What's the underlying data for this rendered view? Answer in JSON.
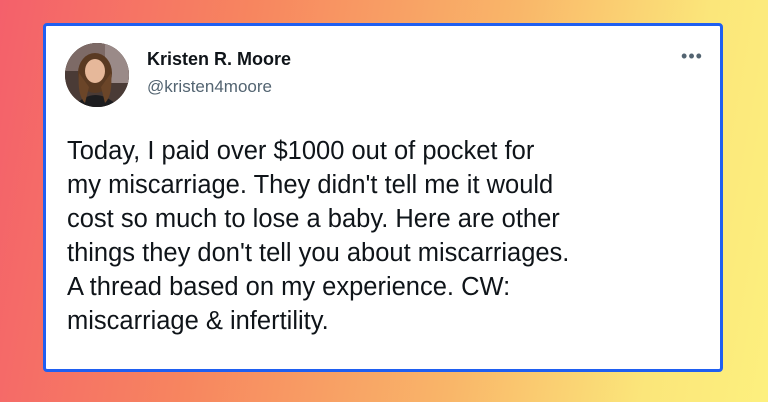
{
  "tweet": {
    "author_name": "Kristen R. Moore",
    "author_handle": "@kristen4moore",
    "more_icon": "more-horizontal-icon",
    "body_lines": [
      "Today, I paid over $1000 out of pocket for",
      "my miscarriage. They didn't tell me it would",
      "cost so much to lose a baby. Here are other",
      "things they don't tell you about miscarriages.",
      "A thread based on my experience. CW:",
      "miscarriage & infertility."
    ]
  },
  "colors": {
    "card_border": "#1f5ff1",
    "text_primary": "#0f1419",
    "text_secondary": "#536471"
  }
}
